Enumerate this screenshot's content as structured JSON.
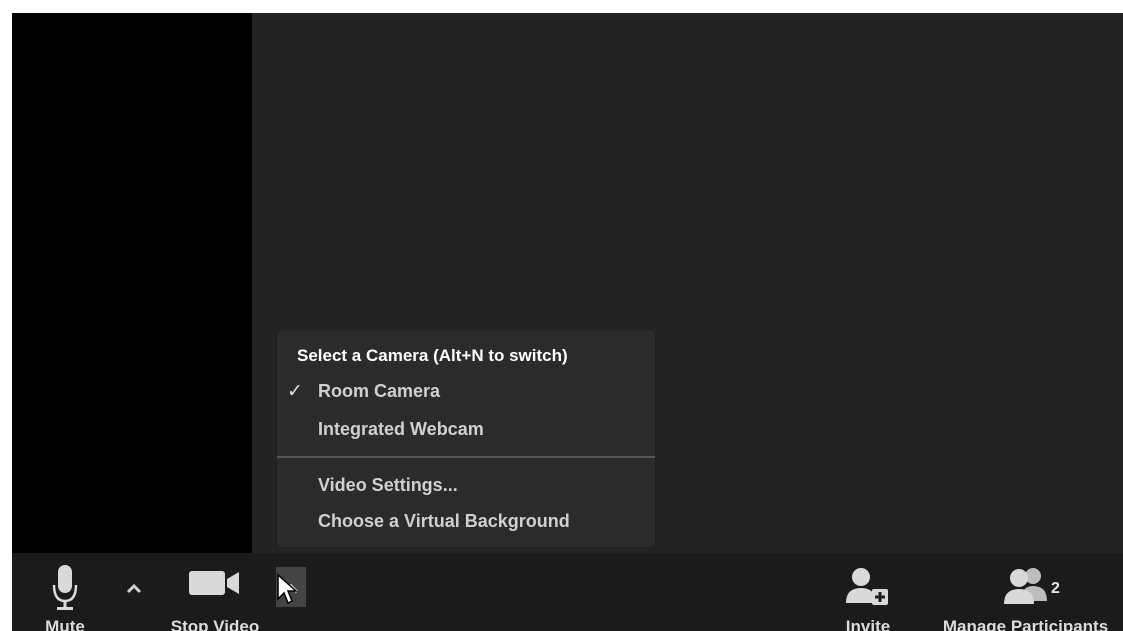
{
  "camera_menu": {
    "header": "Select a Camera (Alt+N to switch)",
    "items": [
      {
        "label": "Room Camera",
        "checked": true
      },
      {
        "label": "Integrated Webcam",
        "checked": false
      }
    ],
    "actions": [
      {
        "label": "Video Settings..."
      },
      {
        "label": "Choose a Virtual Background"
      }
    ],
    "check_glyph": "✓"
  },
  "toolbar": {
    "mute": {
      "label": "Mute",
      "icon": "microphone-icon"
    },
    "audio_options": {
      "icon": "chevron-up-icon"
    },
    "stop_video": {
      "label": "Stop Video",
      "icon": "video-camera-icon"
    },
    "video_options": {
      "icon": "chevron-up-icon",
      "active": true
    },
    "invite": {
      "label": "Invite",
      "icon": "add-user-icon"
    },
    "manage_participants": {
      "label": "Manage Participants",
      "icon": "participants-icon",
      "count": "2"
    }
  },
  "colors": {
    "window_bg": "#232323",
    "toolbar_bg": "#1b1b1b",
    "menu_bg": "#2b2b2b",
    "text": "#dcdcdc"
  }
}
